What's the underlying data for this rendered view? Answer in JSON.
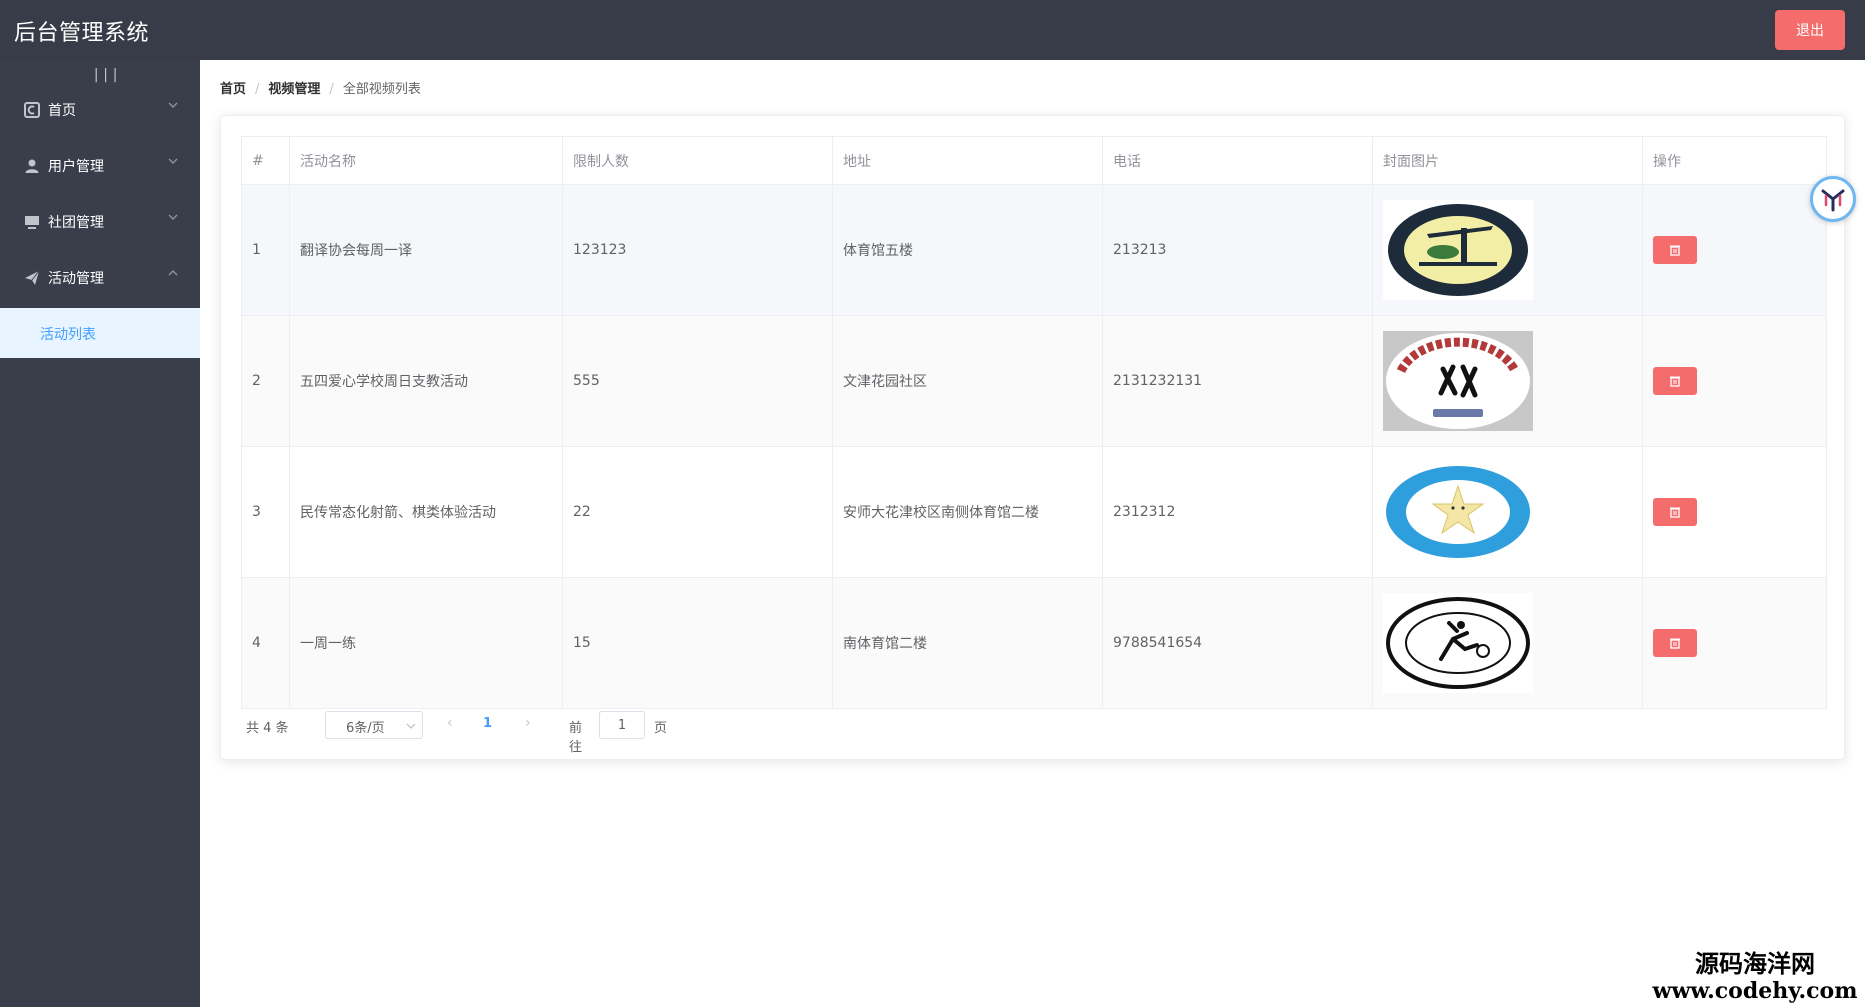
{
  "header": {
    "title": "后台管理系统",
    "logout_label": "退出"
  },
  "sidebar": {
    "collapse_icon": "menu-toggle-icon",
    "items": [
      {
        "label": "首页",
        "icon": "home-icon",
        "expanded": false
      },
      {
        "label": "用户管理",
        "icon": "user-icon",
        "expanded": false
      },
      {
        "label": "社团管理",
        "icon": "monitor-icon",
        "expanded": false
      },
      {
        "label": "活动管理",
        "icon": "send-icon",
        "expanded": true
      }
    ],
    "submenu": {
      "label": "活动列表",
      "active": true
    }
  },
  "breadcrumb": {
    "home": "首页",
    "section": "视频管理",
    "current": "全部视频列表"
  },
  "table": {
    "columns": [
      "#",
      "活动名称",
      "限制人数",
      "地址",
      "电话",
      "封面图片",
      "操作"
    ],
    "rows": [
      {
        "index": "1",
        "name": "翻译协会每周一译",
        "limit": "123123",
        "address": "体育馆五楼",
        "phone": "213213",
        "cover": "club-logo-translation"
      },
      {
        "index": "2",
        "name": "五四爱心学校周日支教活动",
        "limit": "555",
        "address": "文津花园社区",
        "phone": "2131232131",
        "cover": "club-logo-jhcos"
      },
      {
        "index": "3",
        "name": "民传常态化射箭、棋类体验活动",
        "limit": "22",
        "address": "安师大花津校区南侧体育馆二楼",
        "phone": "2312312",
        "cover": "club-logo-star"
      },
      {
        "index": "4",
        "name": "一周一练",
        "limit": "15",
        "address": "南体育馆二楼",
        "phone": "9788541654",
        "cover": "club-logo-sports"
      }
    ],
    "action_icon": "trash-icon"
  },
  "pagination": {
    "total": "共 4 条",
    "page_size": "6条/页",
    "current_page": "1",
    "goto_label": "前往",
    "goto_value": "1",
    "page_label": "页"
  },
  "watermark": {
    "line1": "源码海洋网",
    "line2": "www.codehy.com"
  },
  "colors": {
    "topbar": "#383c48",
    "sidebar": "#3a3e4b",
    "danger": "#f56c6c",
    "primary": "#409eff",
    "submenu_bg": "#e8f4ff"
  }
}
